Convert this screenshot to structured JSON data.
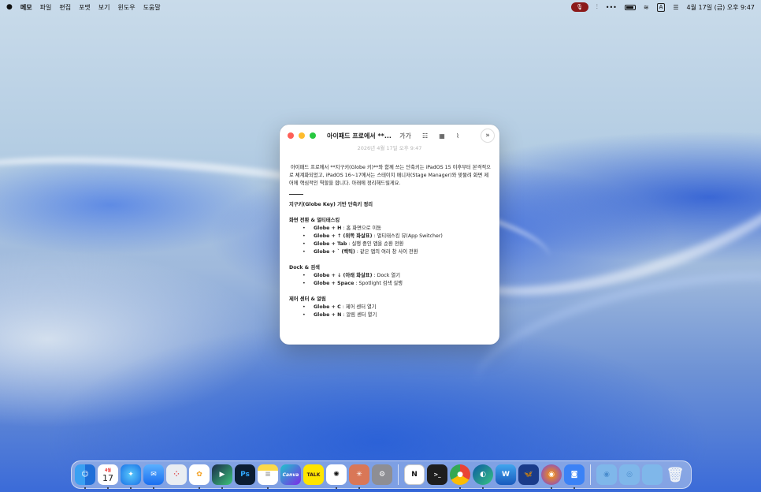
{
  "menubar": {
    "apple": "",
    "app_name": "메모",
    "menus": [
      "파일",
      "편집",
      "포맷",
      "보기",
      "윈도우",
      "도움말"
    ],
    "datetime": "4월 17일 (금) 오후 9:47",
    "input_indicator": "A"
  },
  "window": {
    "title": "아이패드 프로에서 **...",
    "font_tool": "가가",
    "date": "2026년 4월 17일 오후 9:47"
  },
  "note": {
    "intro": "아이패드 프로에서 **지구키(Globe 키)**와 함께 쓰는 단축키는 iPadOS 15 이후부터 본격적으로 체계화되었고, iPadOS 16~17에서는 스테이지 매니저(Stage Manager)와 맞물려 화면 제어에 핵심적인 역할을 합니다. 아래에 정리해드릴게요.",
    "heading": "지구키(Globe Key) 기반 단축키 정리",
    "sections": [
      {
        "title": "화면 전환 & 멀티태스킹",
        "items": [
          {
            "key": "Globe + H",
            "desc": " : 홈 화면으로 이동"
          },
          {
            "key": "Globe + ↑ (위쪽 화살표)",
            "desc": " : 멀티태스킹 뷰(App Switcher)"
          },
          {
            "key": "Globe + Tab",
            "desc": " : 실행 중인 앱을 순환 전환"
          },
          {
            "key": "Globe + ` (백틱)",
            "desc": " : 같은 앱의 여러 창 사이 전환"
          }
        ]
      },
      {
        "title": "Dock & 검색",
        "items": [
          {
            "key": "Globe + ↓ (아래 화살표)",
            "desc": " : Dock 열기"
          },
          {
            "key": "Globe + Space",
            "desc": " : Spotlight 검색 실행"
          }
        ]
      },
      {
        "title": "제어 센터 & 알림",
        "items": [
          {
            "key": "Globe + C",
            "desc": " : 제어 센터 열기"
          },
          {
            "key": "Globe + N",
            "desc": " : 알림 센터 열기"
          }
        ]
      }
    ]
  },
  "dock": {
    "calendar_day": "17",
    "calendar_month": "4월",
    "photoshop_label": "Ps",
    "canva_label": "Canva",
    "kakao_label": "TALK",
    "word_label": "W",
    "notion_label": "N",
    "terminal_label": ">_"
  },
  "colors": {
    "close": "#fe5f57",
    "minimize": "#febc2e",
    "zoom": "#28c840"
  }
}
